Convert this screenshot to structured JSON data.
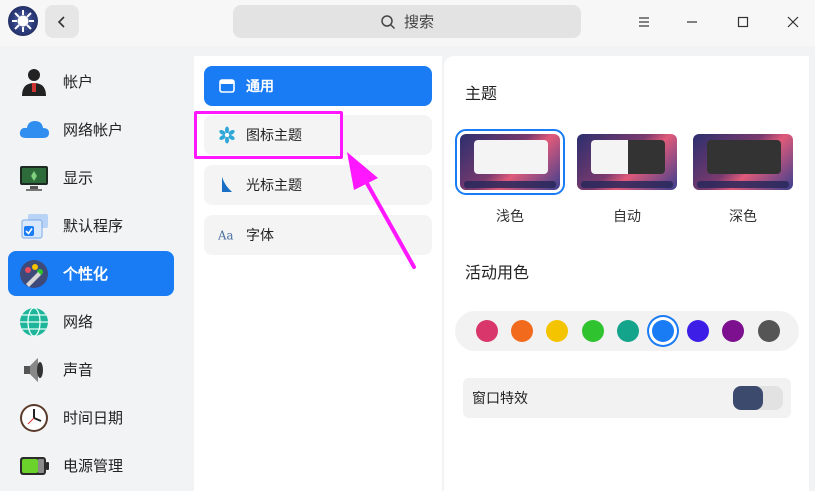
{
  "titlebar": {
    "search_placeholder": "搜索"
  },
  "sidebar": {
    "items": [
      {
        "label": "帐户",
        "icon": "account-avatar-icon"
      },
      {
        "label": "网络帐户",
        "icon": "cloud-icon"
      },
      {
        "label": "显示",
        "icon": "monitor-icon"
      },
      {
        "label": "默认程序",
        "icon": "default-apps-icon"
      },
      {
        "label": "个性化",
        "icon": "personalization-icon",
        "active": true
      },
      {
        "label": "网络",
        "icon": "network-globe-icon"
      },
      {
        "label": "声音",
        "icon": "speaker-icon"
      },
      {
        "label": "时间日期",
        "icon": "clock-icon"
      },
      {
        "label": "电源管理",
        "icon": "battery-icon"
      }
    ]
  },
  "middle": {
    "items": [
      {
        "label": "通用",
        "icon": "window-icon",
        "active": true
      },
      {
        "label": "图标主题",
        "icon": "icon-theme-icon"
      },
      {
        "label": "光标主题",
        "icon": "cursor-icon"
      },
      {
        "label": "字体",
        "icon": "font-icon"
      }
    ]
  },
  "right": {
    "theme_title": "主题",
    "themes": [
      {
        "label": "浅色",
        "selected": true
      },
      {
        "label": "自动"
      },
      {
        "label": "深色"
      }
    ],
    "accent_title": "活动用色",
    "accent_colors": [
      "#d9366b",
      "#f26b1d",
      "#f5c400",
      "#2fc32f",
      "#14a38b",
      "#1a7cf5",
      "#3d1ee6",
      "#7c108e",
      "#555555"
    ],
    "accent_selected": "#1a7cf5",
    "effects_label": "窗口特效",
    "effects_enabled": true
  },
  "colors": {
    "accent": "#1a7cf5",
    "highlight": "#ff18ff"
  }
}
